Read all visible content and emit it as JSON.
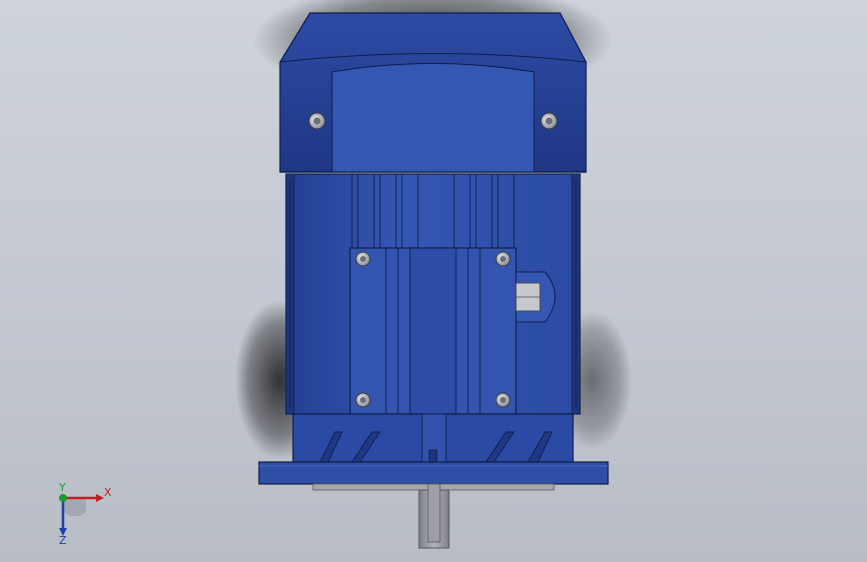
{
  "viewport": {
    "background_top": "#ced3db",
    "background_bottom": "#b7bcc5"
  },
  "model": {
    "description_icon": "electric-motor-model",
    "body_color": "#2f4ea6",
    "body_dark": "#1e347c",
    "body_light": "#4466c0",
    "shaft_color": "#9a9ca3",
    "fastener_color": "#c9ccd2"
  },
  "triad": {
    "x_label": "X",
    "y_label": "Y",
    "z_label": "Z",
    "x_color": "#c02020",
    "y_color": "#1c9c2c",
    "z_color": "#1f3fae"
  }
}
